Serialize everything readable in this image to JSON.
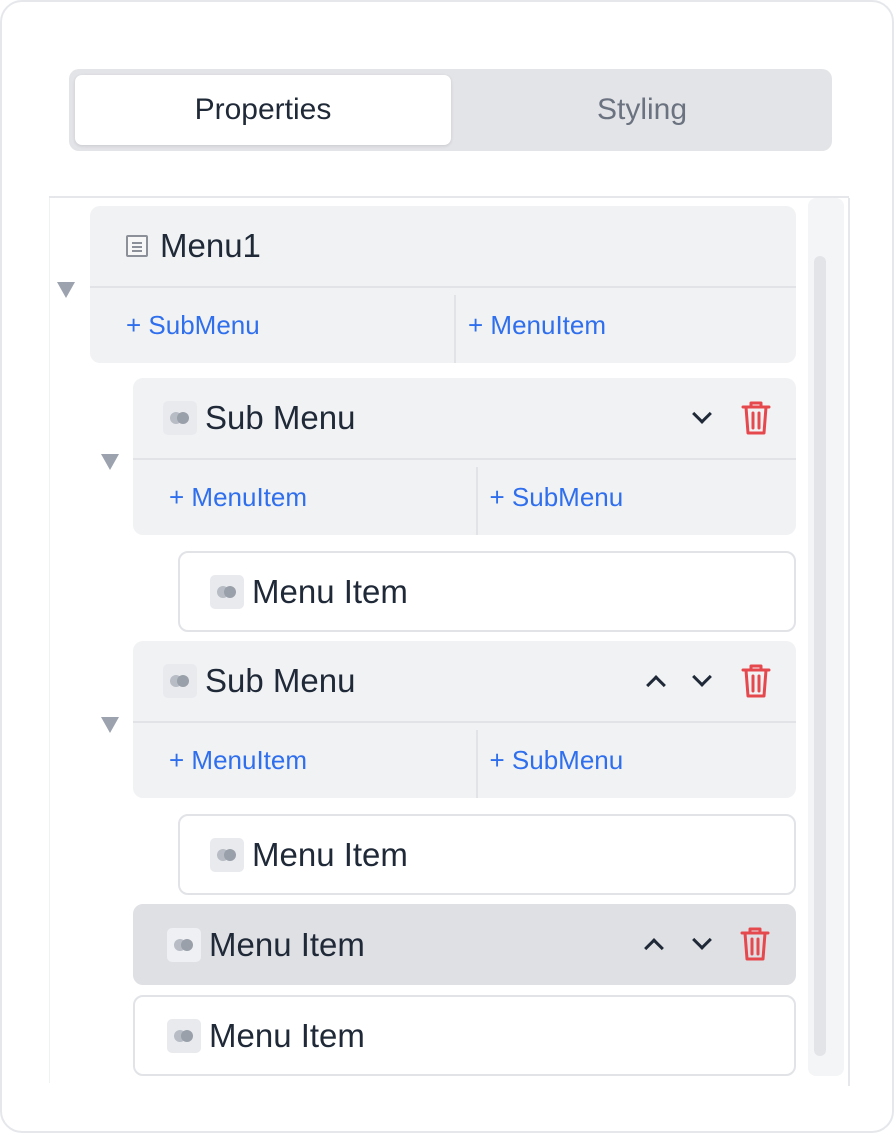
{
  "tabs": [
    {
      "label": "Properties",
      "active": true
    },
    {
      "label": "Styling",
      "active": false
    }
  ],
  "tree": {
    "root": {
      "label": "Menu1",
      "icon": "menu-list-icon",
      "actions": [
        "+ SubMenu",
        "+ MenuItem"
      ]
    },
    "submenu1": {
      "label": "Sub Menu",
      "icon": "component-icon",
      "actions": [
        "+ MenuItem",
        "+ SubMenu"
      ],
      "child": {
        "label": "Menu Item",
        "icon": "component-icon"
      }
    },
    "submenu2": {
      "label": "Sub Menu",
      "icon": "component-icon",
      "actions": [
        "+ MenuItem",
        "+ SubMenu"
      ],
      "child": {
        "label": "Menu Item",
        "icon": "component-icon"
      }
    },
    "item_selected": {
      "label": "Menu Item",
      "icon": "component-icon"
    },
    "item_last": {
      "label": "Menu Item",
      "icon": "component-icon"
    }
  },
  "colors": {
    "accent_link": "#2f6fed",
    "delete_red": "#e5484d",
    "selected_bg": "#dfe0e4"
  }
}
